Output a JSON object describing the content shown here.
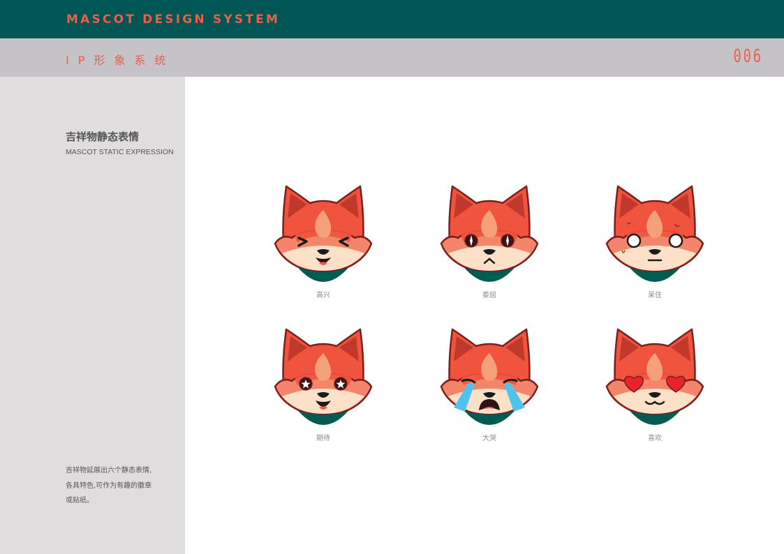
{
  "header": {
    "title": "MASCOT DESIGN SYSTEM",
    "subtitle": "IP形象系统",
    "page_number": "006"
  },
  "sidebar": {
    "section_title": "吉祥物静态表情",
    "section_subtitle": "MASCOT STATIC EXPRESSION",
    "description_lines": [
      "吉祥物延展出六个静态表情,",
      "各具特色,可作为有趣的徽章",
      "或贴纸。"
    ]
  },
  "expressions": [
    {
      "label": "高兴",
      "icon": "fox-happy-icon"
    },
    {
      "label": "委屈",
      "icon": "fox-aggrieved-icon"
    },
    {
      "label": "呆住",
      "icon": "fox-stunned-icon"
    },
    {
      "label": "期待",
      "icon": "fox-expectant-icon"
    },
    {
      "label": "大哭",
      "icon": "fox-crying-icon"
    },
    {
      "label": "喜欢",
      "icon": "fox-love-icon"
    }
  ],
  "colors": {
    "header_bg": "#005652",
    "subheader_bg": "#c5c3c7",
    "sidebar_bg": "#e0dddf",
    "accent": "#e8604c",
    "fox_orange": "#f0533e",
    "fox_outline": "#7a1e1e",
    "scarf": "#005c52",
    "tear_blue": "#4dc3ee"
  }
}
